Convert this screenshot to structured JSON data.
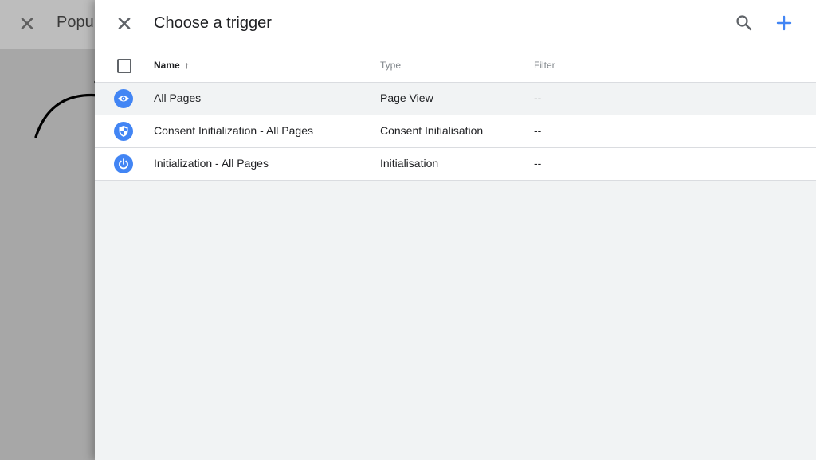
{
  "background": {
    "title": "Popu",
    "close_icon": "close-icon"
  },
  "panel": {
    "title": "Choose a trigger",
    "close_icon": "close-icon",
    "search_icon": "search-icon",
    "add_icon": "plus-icon",
    "accent_color": "#4285f4"
  },
  "table": {
    "columns": {
      "name": "Name",
      "type": "Type",
      "filter": "Filter"
    },
    "sort": "ascending",
    "rows": [
      {
        "icon": "eye-icon",
        "name": "All Pages",
        "type": "Page View",
        "filter": "--"
      },
      {
        "icon": "shield-icon",
        "name": "Consent Initialization - All Pages",
        "type": "Consent Initialisation",
        "filter": "--"
      },
      {
        "icon": "power-icon",
        "name": "Initialization - All Pages",
        "type": "Initialisation",
        "filter": "--"
      }
    ]
  }
}
